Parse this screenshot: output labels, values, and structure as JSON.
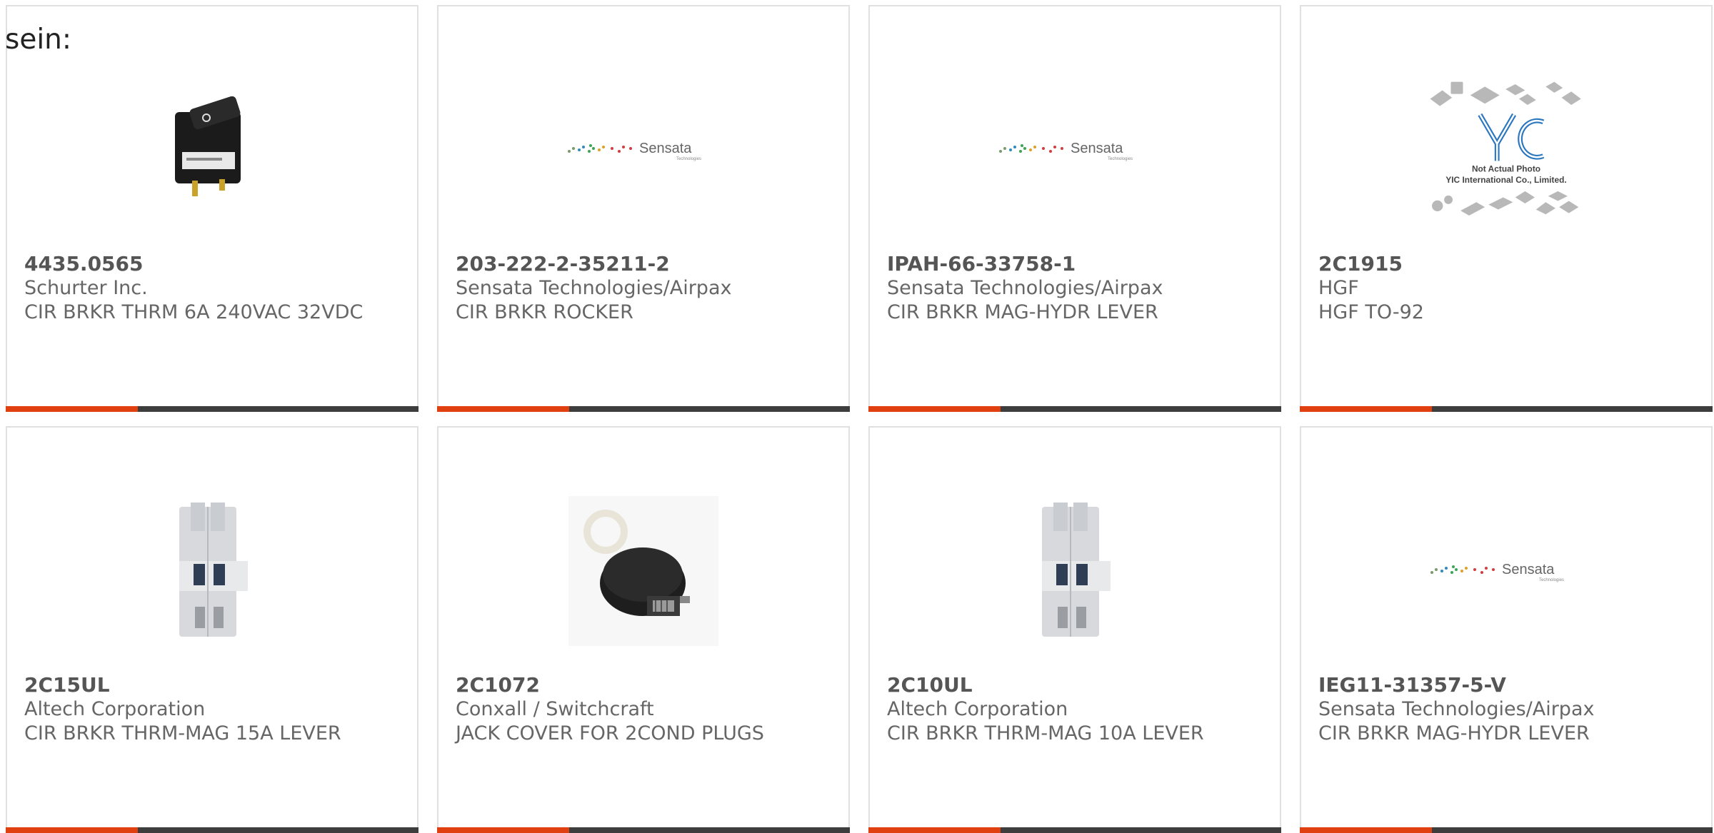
{
  "page": {
    "prefix_text": "sein:"
  },
  "accent_color": "#e0400f",
  "bar_color": "#3d3d3d",
  "products": [
    {
      "part_number": "4435.0565",
      "manufacturer": "Schurter Inc.",
      "description": "CIR BRKR THRM 6A 240VAC 32VDC",
      "image": "rocker-switch-icon"
    },
    {
      "part_number": "203-222-2-35211-2",
      "manufacturer": "Sensata Technologies/Airpax",
      "description": "CIR BRKR ROCKER",
      "image": "sensata-logo",
      "logo_text": "Sensata",
      "logo_sub": "Technologies"
    },
    {
      "part_number": "IPAH-66-33758-1",
      "manufacturer": "Sensata Technologies/Airpax",
      "description": "CIR BRKR MAG-HYDR LEVER",
      "image": "sensata-logo",
      "logo_text": "Sensata",
      "logo_sub": "Technologies"
    },
    {
      "part_number": "2C1915",
      "manufacturer": "HGF",
      "description": "HGF TO-92",
      "image": "yic-placeholder",
      "placeholder_line1": "Not Actual Photo",
      "placeholder_line2": "YIC International Co., Limited."
    },
    {
      "part_number": "2C15UL",
      "manufacturer": "Altech Corporation",
      "description": "CIR BRKR THRM-MAG 15A LEVER",
      "image": "din-breaker-icon"
    },
    {
      "part_number": "2C1072",
      "manufacturer": "Conxall / Switchcraft",
      "description": "JACK COVER FOR 2COND PLUGS",
      "image": "jack-cover-icon"
    },
    {
      "part_number": "2C10UL",
      "manufacturer": "Altech Corporation",
      "description": "CIR BRKR THRM-MAG 10A LEVER",
      "image": "din-breaker-icon"
    },
    {
      "part_number": "IEG11-31357-5-V",
      "manufacturer": "Sensata Technologies/Airpax",
      "description": "CIR BRKR MAG-HYDR LEVER",
      "image": "sensata-logo",
      "logo_text": "Sensata",
      "logo_sub": "Technologies"
    }
  ]
}
